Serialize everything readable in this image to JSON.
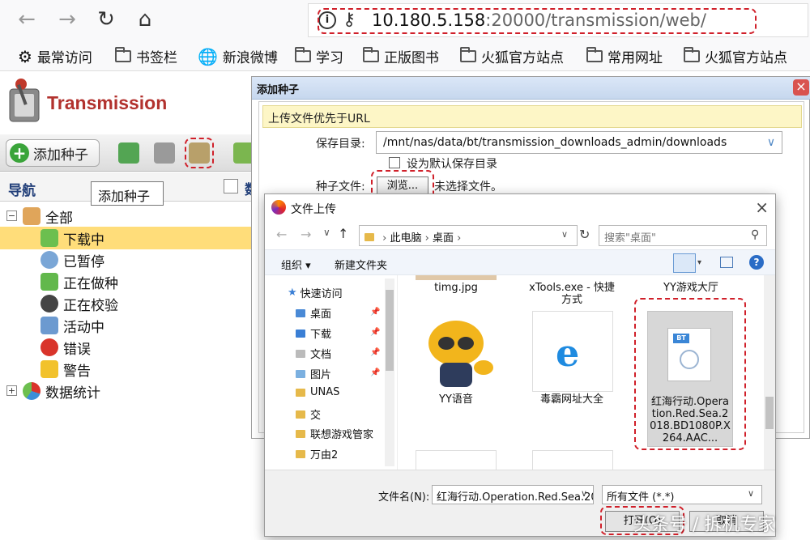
{
  "browser": {
    "url_host": "10.180.5.158",
    "url_rest": ":20000/transmission/web/",
    "bookmarks": [
      "最常访问",
      "书签栏",
      "新浪微博",
      "学习",
      "正版图书",
      "火狐官方站点",
      "常用网址",
      "火狐官方站点"
    ]
  },
  "app": {
    "name": "Transmission",
    "add_torrent_label": "添加种子",
    "tooltip": "添加种子",
    "nav_title": "导航",
    "nav_right_partial": "数",
    "tree": [
      "全部",
      "下载中",
      "已暂停",
      "正在做种",
      "正在校验",
      "活动中",
      "错误",
      "警告",
      "数据统计"
    ]
  },
  "add_dialog": {
    "title": "添加种子",
    "hint": "上传文件优先于URL",
    "save_dir_label": "保存目录:",
    "save_dir_value": "/mnt/nas/data/bt/transmission_downloads_admin/downloads",
    "default_dir_label": "设为默认保存目录",
    "torrent_file_label": "种子文件:",
    "browse_label": "浏览...",
    "no_file_label": "未选择文件。"
  },
  "upload_dialog": {
    "title": "文件上传",
    "path": [
      "此电脑",
      "桌面"
    ],
    "search_placeholder": "搜索\"桌面\"",
    "organize_label": "组织 ▾",
    "new_folder_label": "新建文件夹",
    "quick_access": "快速访问",
    "sidebar": [
      "桌面",
      "下载",
      "文档",
      "图片",
      "UNAS",
      "交",
      "联想游戏管家",
      "万由2"
    ],
    "files": [
      {
        "name": "timg.jpg"
      },
      {
        "name": "xTools.exe - 快捷方式"
      },
      {
        "name": "YY游戏大厅"
      },
      {
        "name": "YY语音"
      },
      {
        "name": "毒霸网址大全"
      },
      {
        "name": "红海行动.Operation.Red.Sea.2018.BD1080P.X264.AAC..."
      }
    ],
    "filename_label": "文件名(N):",
    "filename_value": "红海行动.Operation.Red.Sea.20",
    "filetype_value": "所有文件 (*.*)",
    "open_label": "打开(O)",
    "cancel_label": "取消"
  },
  "watermark": "头条号 / 拆机专家"
}
